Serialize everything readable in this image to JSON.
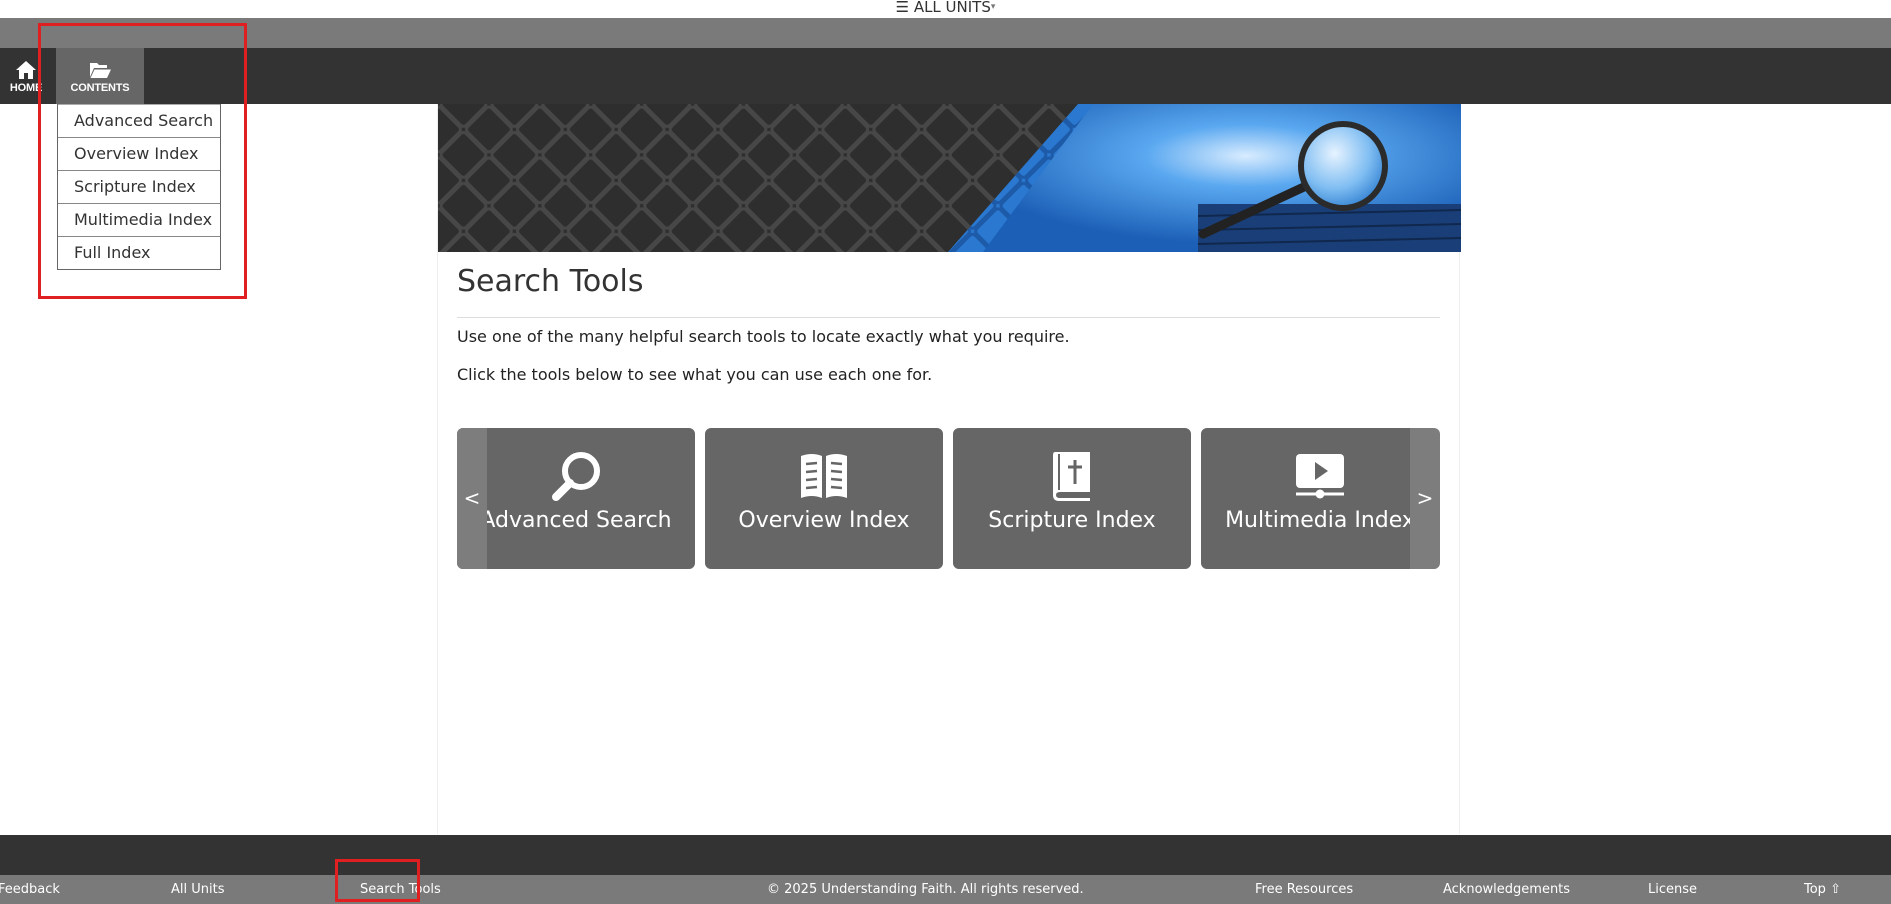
{
  "top_bar": {
    "menu_glyph": "☰",
    "units_label": "ALL UNITS",
    "caret": "▾"
  },
  "nav": {
    "home_label": "HOME",
    "home_icon": "home-icon",
    "contents_label": "CONTENTS",
    "contents_icon": "folder-open-icon"
  },
  "dropdown": {
    "items": [
      "Advanced Search",
      "Overview Index",
      "Scripture Index",
      "Multimedia Index",
      "Full Index"
    ]
  },
  "main": {
    "title": "Search Tools",
    "intro": "Use one of the many helpful search tools to locate exactly what you require.",
    "instructions": "Click the tools below to see what you can use each one for."
  },
  "carousel": {
    "prev_label": "<",
    "next_label": ">",
    "cards": [
      {
        "label": "Advanced Search",
        "icon": "magnifier-icon"
      },
      {
        "label": "Overview Index",
        "icon": "open-book-icon"
      },
      {
        "label": "Scripture Index",
        "icon": "bible-icon"
      },
      {
        "label": "Multimedia Index",
        "icon": "video-player-icon"
      }
    ]
  },
  "footer": {
    "feedback": "Feedback",
    "all_units": "All Units",
    "search_tools": "Search Tools",
    "copyright": "© 2025 Understanding Faith. All rights reserved.",
    "free_resources": "Free Resources",
    "acknowledgements": "Acknowledgements",
    "license": "License",
    "top": "Top ⇧"
  },
  "colors": {
    "nav_dark": "#333333",
    "nav_active": "#666666",
    "strip_grey": "#7a7a7a",
    "card_grey": "#666666",
    "highlight_red": "#e02020",
    "banner_blue": "#2a78d0"
  }
}
